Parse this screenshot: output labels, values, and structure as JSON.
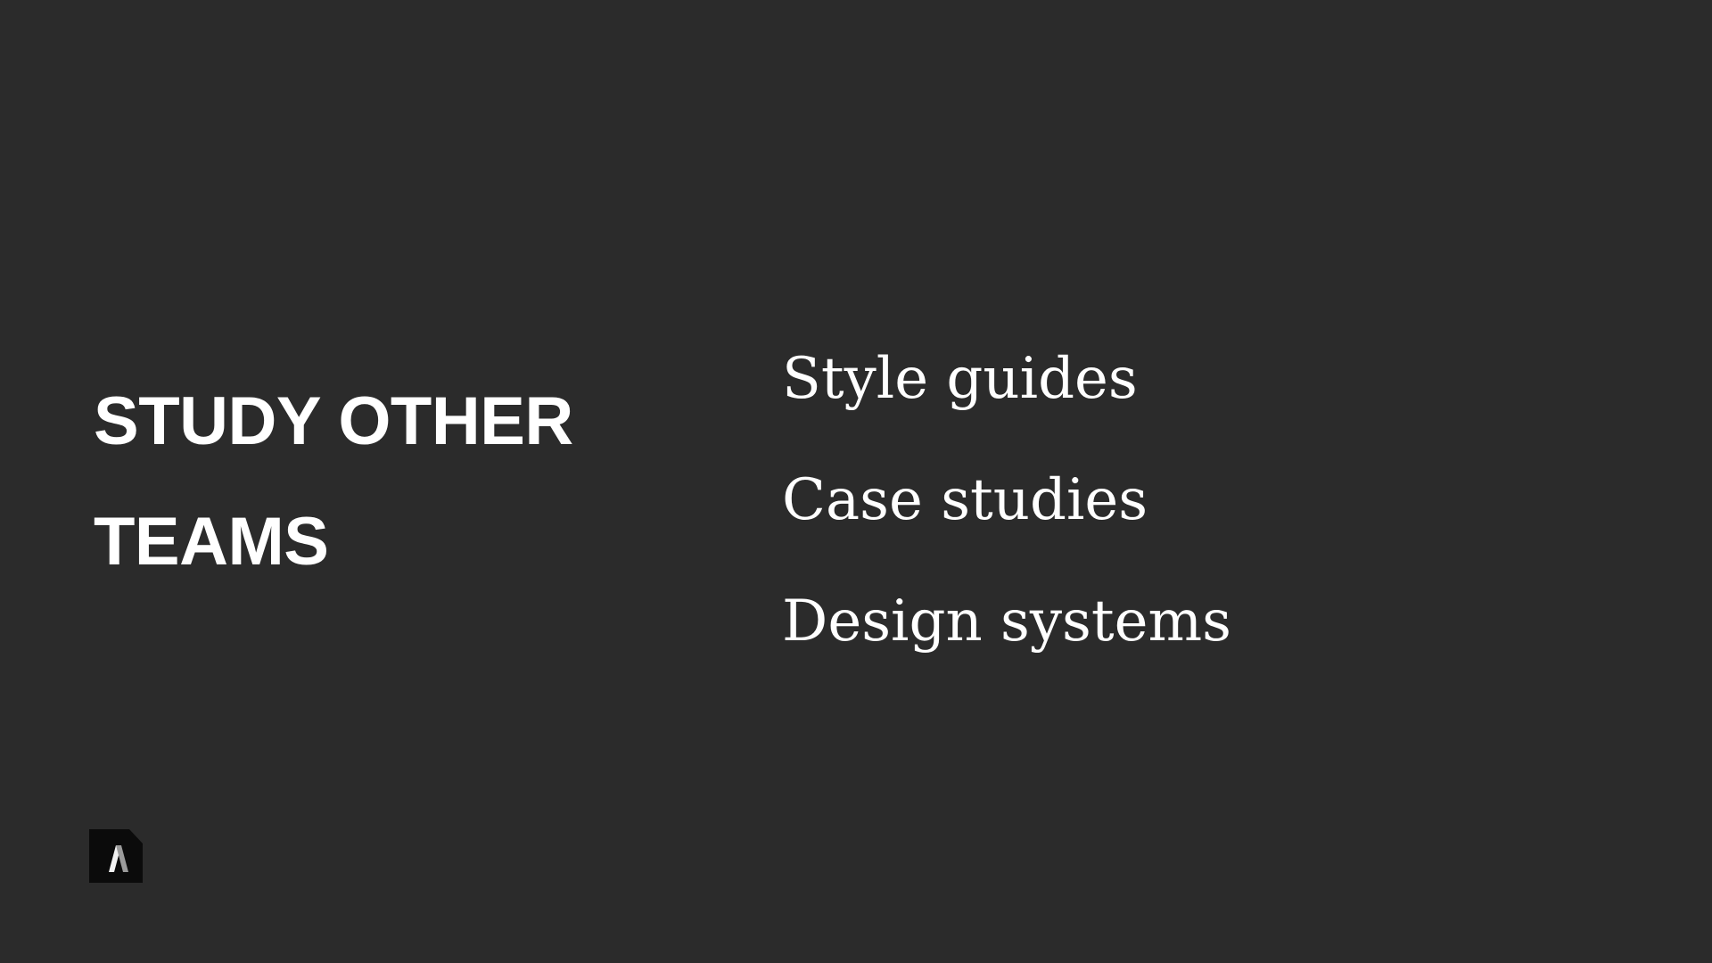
{
  "slide": {
    "title_lines": [
      "STUDY OTHER",
      "TEAMS"
    ],
    "items": [
      "Style guides",
      "Case studies",
      "Design systems"
    ],
    "logo_icon": "brand-logo-icon"
  },
  "colors": {
    "background": "#2b2b2b",
    "text": "#ffffff",
    "logo_background": "#0b0b0b"
  }
}
